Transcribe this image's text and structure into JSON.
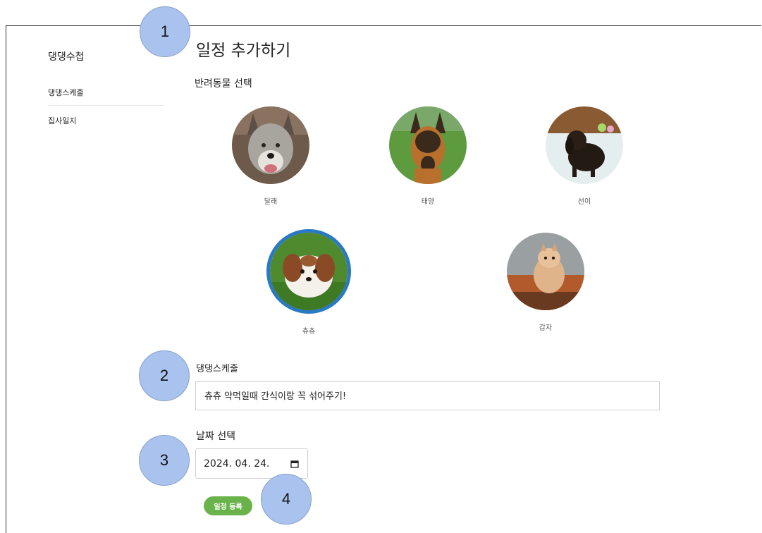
{
  "sidebar": {
    "brand": "댕댕수첩",
    "items": [
      {
        "label": "댕댕스케줄"
      },
      {
        "label": "집사일지"
      }
    ]
  },
  "main": {
    "title": "일정 추가하기",
    "pet_section_label": "반려동물 선택",
    "pets": [
      {
        "name": "달래",
        "selected": false
      },
      {
        "name": "태양",
        "selected": false
      },
      {
        "name": "선이",
        "selected": false
      },
      {
        "name": "츄츄",
        "selected": true
      },
      {
        "name": "감자",
        "selected": false
      }
    ],
    "schedule_label": "댕댕스케줄",
    "schedule_value": "츄츄 약먹일때 간식이랑 꼭 섞어주기!",
    "date_label": "날짜 선택",
    "date_value": "2024. 04. 24.",
    "submit_label": "일정 등록"
  },
  "callouts": [
    "1",
    "2",
    "3",
    "4"
  ],
  "colors": {
    "accent_blue": "#2979c4",
    "button_green": "#6ab24a",
    "callout_blue": "#a9c3ee"
  }
}
